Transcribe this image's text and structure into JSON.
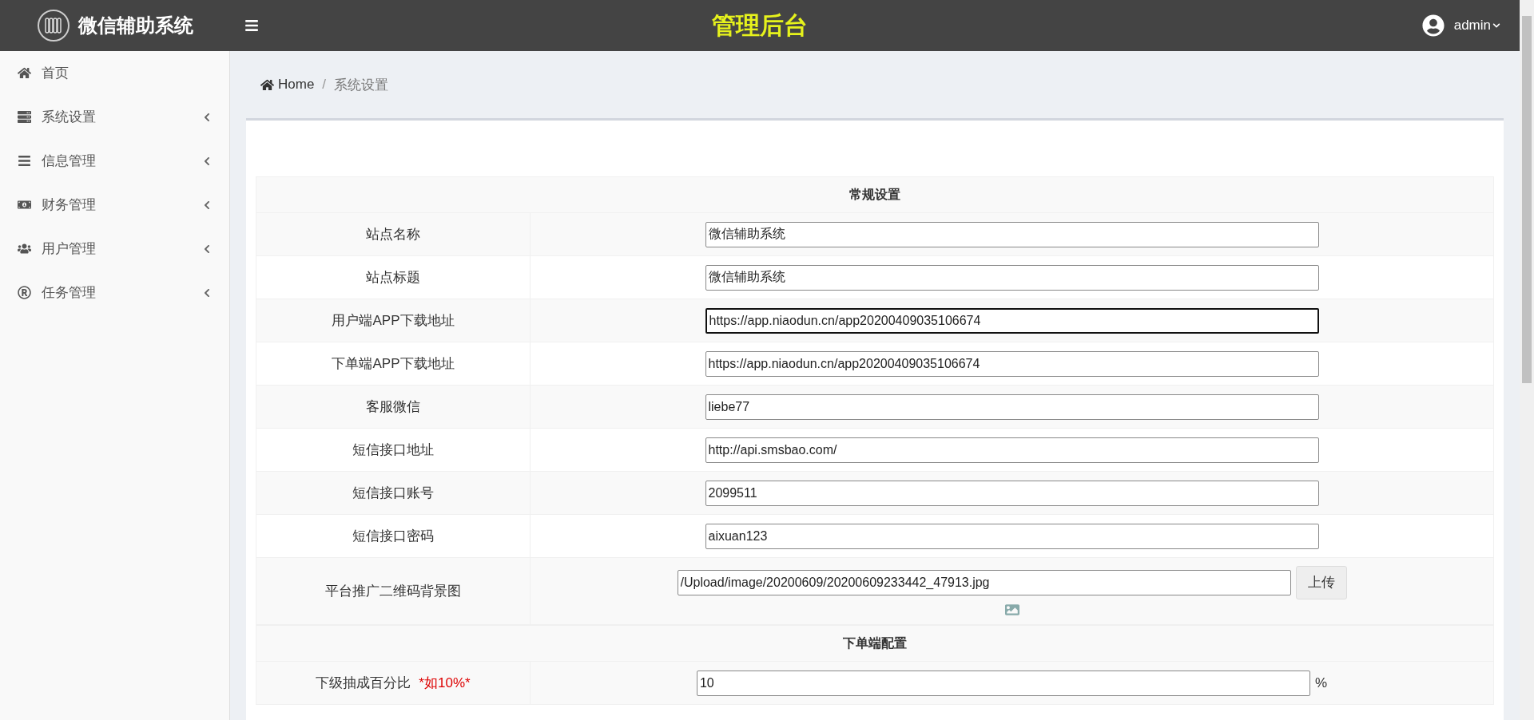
{
  "header": {
    "brand": "微信辅助系统",
    "title": "管理后台",
    "user": "admin"
  },
  "sidebar": {
    "items": [
      {
        "label": "首页",
        "expandable": false
      },
      {
        "label": "系统设置",
        "expandable": true
      },
      {
        "label": "信息管理",
        "expandable": true
      },
      {
        "label": "财务管理",
        "expandable": true
      },
      {
        "label": "用户管理",
        "expandable": true
      },
      {
        "label": "任务管理",
        "expandable": true
      }
    ]
  },
  "breadcrumb": {
    "home": "Home",
    "separator": "/",
    "current": "系统设置"
  },
  "form": {
    "rows": [
      {
        "kind": "section",
        "label": "常规设置"
      },
      {
        "kind": "field",
        "label": "站点名称",
        "value": "微信辅助系统",
        "focused": false
      },
      {
        "kind": "field",
        "label": "站点标题",
        "value": "微信辅助系统",
        "focused": false
      },
      {
        "kind": "field",
        "label": "用户端APP下载地址",
        "value": "https://app.niaodun.cn/app20200409035106674",
        "focused": true
      },
      {
        "kind": "field",
        "label": "下单端APP下载地址",
        "value": "https://app.niaodun.cn/app20200409035106674",
        "focused": false
      },
      {
        "kind": "field",
        "label": "客服微信",
        "value": "liebe77",
        "focused": false
      },
      {
        "kind": "field",
        "label": "短信接口地址",
        "value": "http://api.smsbao.com/",
        "focused": false
      },
      {
        "kind": "field",
        "label": "短信接口账号",
        "value": "2099511",
        "focused": false
      },
      {
        "kind": "field",
        "label": "短信接口密码",
        "value": "aixuan123",
        "focused": false
      },
      {
        "kind": "upload",
        "label": "平台推广二维码背景图",
        "value": "/Upload/image/20200609/20200609233442_47913.jpg",
        "button": "上传"
      },
      {
        "kind": "section",
        "label": "下单端配置"
      },
      {
        "kind": "percent",
        "label": "下级抽成百分比",
        "hint": "*如10%*",
        "value": "10",
        "unit": "%"
      }
    ]
  }
}
